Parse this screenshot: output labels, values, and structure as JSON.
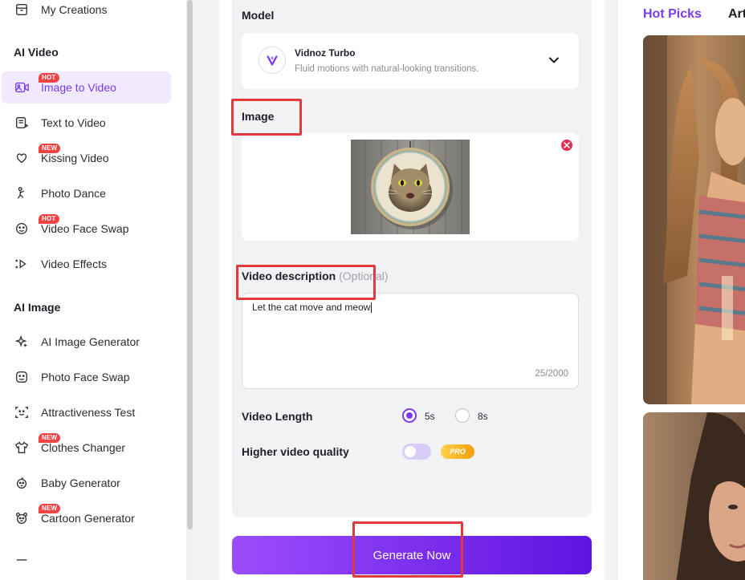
{
  "sidebar": {
    "top_item": {
      "label": "My Creations",
      "icon": "archive-icon"
    },
    "sections": [
      {
        "title": "AI Video"
      },
      {
        "title": "AI Image"
      }
    ],
    "video_items": [
      {
        "label": "Image to Video",
        "badge": "HOT",
        "icon": "image-video-icon",
        "active": true
      },
      {
        "label": "Text to Video",
        "badge": "",
        "icon": "text-doc-icon"
      },
      {
        "label": "Kissing Video",
        "badge": "NEW",
        "icon": "heart-icon"
      },
      {
        "label": "Photo Dance",
        "badge": "",
        "icon": "dance-icon"
      },
      {
        "label": "Video Face Swap",
        "badge": "HOT",
        "icon": "face-swap-icon"
      },
      {
        "label": "Video Effects",
        "badge": "",
        "icon": "sparkle-play-icon"
      }
    ],
    "image_items": [
      {
        "label": "AI Image Generator",
        "badge": "",
        "icon": "sparkles-icon"
      },
      {
        "label": "Photo Face Swap",
        "badge": "",
        "icon": "face-icon"
      },
      {
        "label": "Attractiveness Test",
        "badge": "",
        "icon": "face-scan-icon"
      },
      {
        "label": "Clothes Changer",
        "badge": "NEW",
        "icon": "shirt-icon"
      },
      {
        "label": "Baby Generator",
        "badge": "",
        "icon": "baby-icon"
      },
      {
        "label": "Cartoon Generator",
        "badge": "NEW",
        "icon": "cartoon-face-icon"
      }
    ]
  },
  "form": {
    "model_label": "Model",
    "model_name": "Vidnoz Turbo",
    "model_desc": "Fluid motions with natural-looking transitions.",
    "image_label": "Image",
    "desc_label": "Video description",
    "desc_optional": "(Optional)",
    "desc_value": "Let the cat move and meow",
    "desc_counter": "25/2000",
    "length_label": "Video Length",
    "length_options": [
      "5s",
      "8s"
    ],
    "length_selected": "5s",
    "quality_label": "Higher video quality",
    "quality_badge": "PRO",
    "generate_label": "Generate Now"
  },
  "gallery": {
    "tabs": [
      "Hot Picks",
      "Art"
    ]
  },
  "colors": {
    "accent": "#7c3aed",
    "badge": "#ef4444",
    "highlight": "#e0393e"
  }
}
